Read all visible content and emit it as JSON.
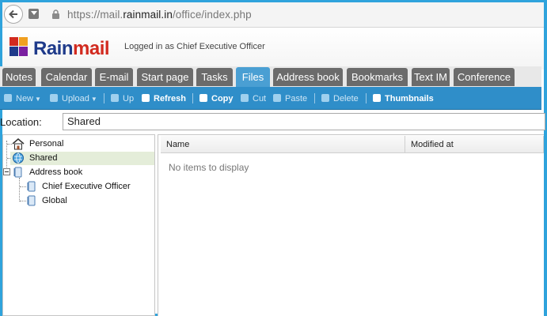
{
  "browser": {
    "url_prefix": "https://mail.",
    "url_domain": "rainmail.in",
    "url_path": "/office/index.php"
  },
  "app": {
    "logo_rain": "Rain",
    "logo_mail": "mail",
    "logged_in_text": "Logged in as Chief Executive Officer"
  },
  "tabs": [
    {
      "label": "Notes",
      "active": false
    },
    {
      "label": "Calendar",
      "active": false
    },
    {
      "label": "E-mail",
      "active": false
    },
    {
      "label": "Start page",
      "active": false
    },
    {
      "label": "Tasks",
      "active": false
    },
    {
      "label": "Files",
      "active": true
    },
    {
      "label": "Address book",
      "active": false
    },
    {
      "label": "Bookmarks",
      "active": false
    },
    {
      "label": "Text IM",
      "active": false
    },
    {
      "label": "Conference",
      "active": false
    }
  ],
  "toolbar": {
    "new": "New",
    "upload": "Upload",
    "up": "Up",
    "refresh": "Refresh",
    "copy": "Copy",
    "cut": "Cut",
    "paste": "Paste",
    "delete": "Delete",
    "thumbnails": "Thumbnails"
  },
  "location": {
    "label": "Location:",
    "value": "Shared"
  },
  "tree": {
    "personal": "Personal",
    "shared": "Shared",
    "address_book": "Address book",
    "ceo": "Chief Executive Officer",
    "global": "Global"
  },
  "grid": {
    "col_name": "Name",
    "col_modified": "Modified at",
    "empty_text": "No items to display"
  },
  "colors": {
    "frame": "#2fa3dc",
    "toolbar": "#2f8ec9",
    "active_tab": "#4a9fd3",
    "tab": "#6b6b6b",
    "logo_blue": "#1e3a8a",
    "logo_red": "#d22a1f"
  }
}
